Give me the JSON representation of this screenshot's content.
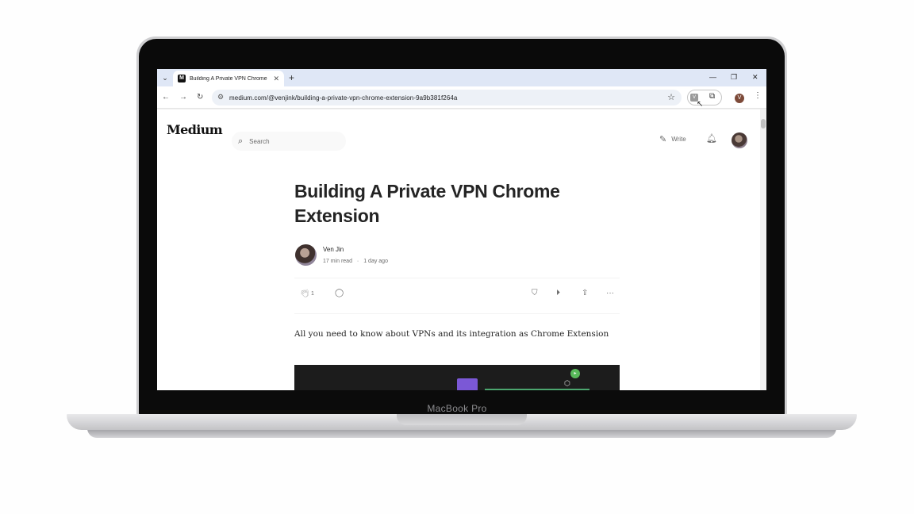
{
  "device": {
    "brand_label": "MacBook Pro"
  },
  "browser": {
    "tab_title": "Building A Private VPN Chrome",
    "tab_favicon_letter": "M",
    "url": "medium.com/@venjink/building-a-private-vpn-chrome-extension-9a9b381f264a",
    "extension_letter": "V",
    "profile_letter": "V"
  },
  "page": {
    "logo": "Medium",
    "search_placeholder": "Search",
    "write_label": "Write",
    "article": {
      "title": "Building A Private VPN Chrome Extension",
      "author": "Ven Jin",
      "read_time": "17 min read",
      "separator": "·",
      "posted": "1 day ago",
      "claps": "1",
      "subtitle": "All you need to know about VPNs and its integration as Chrome Extension"
    }
  },
  "colors": {
    "tabbar": "#dfe7f6",
    "omnibox": "#edf1f7",
    "hero_bg": "#1c1c1c",
    "accent_purple": "#7b58d6",
    "accent_green": "#58b85a"
  },
  "icons": [
    "tab-list-icon",
    "close-icon",
    "plus-icon",
    "minimize-icon",
    "restore-icon",
    "back-icon",
    "forward-icon",
    "reload-icon",
    "site-settings-icon",
    "star-icon",
    "extension-icon",
    "puzzle-icon",
    "cursor-icon",
    "more-icon",
    "search-icon",
    "write-icon",
    "bell-icon",
    "clap-icon",
    "comment-icon",
    "bookmark-icon",
    "play-icon",
    "share-icon",
    "ellipsis-icon"
  ]
}
